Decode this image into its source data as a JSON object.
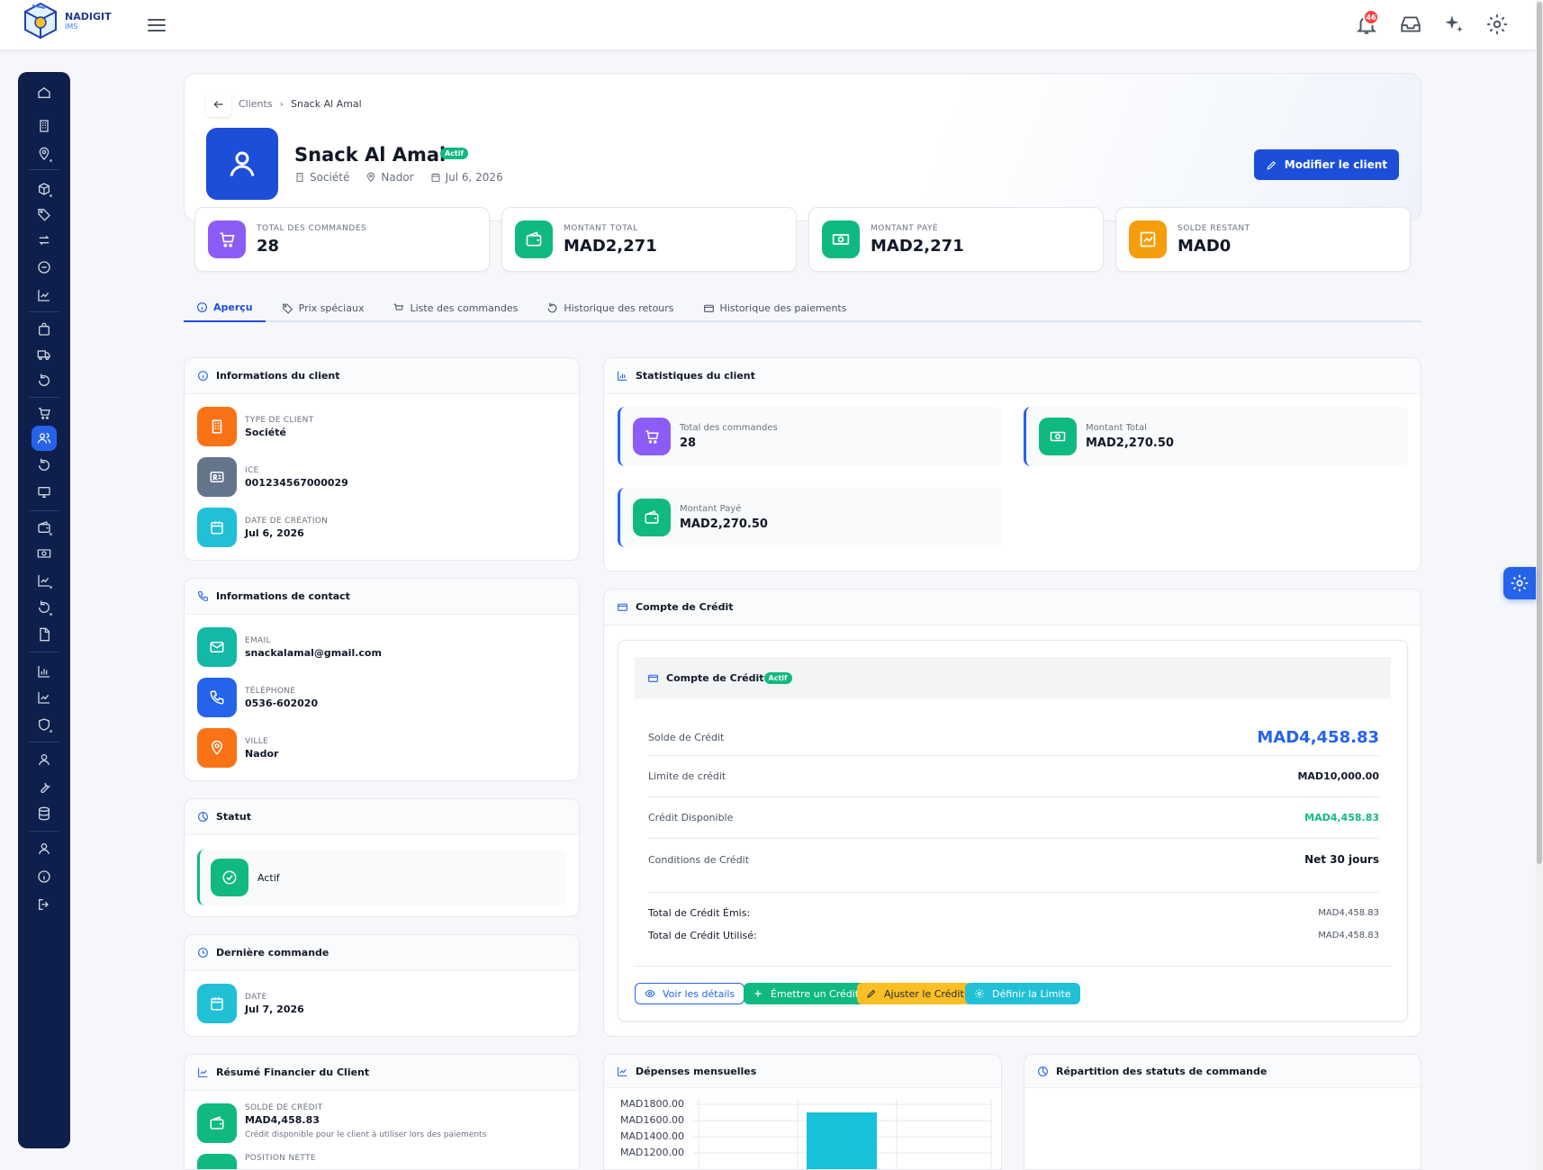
{
  "app": {
    "name": "NADIGIT",
    "subtitle": "IMS",
    "notification_count": "46"
  },
  "breadcrumb": {
    "parent": "Clients",
    "current": "Snack Al Amal"
  },
  "client": {
    "name": "Snack Al Amal",
    "status_badge": "Actif",
    "type": "Société",
    "city": "Nador",
    "created": "Jul 6, 2026",
    "edit_label": "Modifier le client"
  },
  "kpis": [
    {
      "label": "TOTAL DES COMMANDES",
      "value": "28",
      "color": "#8b5cf6",
      "icon": "cart-icon"
    },
    {
      "label": "MONTANT TOTAL",
      "value": "MAD2,271",
      "color": "#10b981",
      "icon": "wallet-icon"
    },
    {
      "label": "MONTANT PAYÉ",
      "value": "MAD2,271",
      "color": "#10b981",
      "icon": "cash-icon"
    },
    {
      "label": "SOLDE RESTANT",
      "value": "MAD0",
      "color": "#f59e0b",
      "icon": "chart-icon"
    }
  ],
  "tabs": [
    {
      "label": "Aperçu",
      "icon": "info-icon",
      "active": true
    },
    {
      "label": "Prix spéciaux",
      "icon": "tag-icon"
    },
    {
      "label": "Liste des commandes",
      "icon": "cart-icon"
    },
    {
      "label": "Historique des retours",
      "icon": "undo-icon"
    },
    {
      "label": "Historique des paiements",
      "icon": "card-icon"
    }
  ],
  "client_info": {
    "title": "Informations du client",
    "items": [
      {
        "label": "TYPE DE CLIENT",
        "value": "Société"
      },
      {
        "label": "ICE",
        "value": "001234567000029"
      },
      {
        "label": "DATE DE CRÉATION",
        "value": "Jul 6, 2026"
      }
    ]
  },
  "contact_info": {
    "title": "Informations de contact",
    "items": [
      {
        "label": "EMAIL",
        "value": "snackalamal@gmail.com"
      },
      {
        "label": "TÉLÉPHONE",
        "value": "0536-602020"
      },
      {
        "label": "VILLE",
        "value": "Nador"
      }
    ]
  },
  "statut": {
    "title": "Statut",
    "value": "Actif"
  },
  "last_order": {
    "title": "Dernière commande",
    "label": "DATE",
    "value": "Jul 7, 2026"
  },
  "financial_summary": {
    "title": "Résumé Financier du Client",
    "credit_label": "SOLDE DE CRÉDIT",
    "credit_value": "MAD4,458.83",
    "credit_note": "Crédit disponible pour le client à utiliser lors des paiements",
    "net_label": "POSITION NETTE"
  },
  "stats": {
    "title": "Statistiques du client",
    "items": [
      {
        "label": "Total des commandes",
        "value": "28"
      },
      {
        "label": "Montant Total",
        "value": "MAD2,270.50"
      },
      {
        "label": "Montant Payé",
        "value": "MAD2,270.50"
      }
    ]
  },
  "credit": {
    "card_title": "Compte de Crédit",
    "inner_title": "Compte de Crédit",
    "badge": "Actif",
    "balance_label": "Solde de Crédit",
    "balance_value": "MAD4,458.83",
    "limit_label": "Limite de crédit",
    "limit_value": "MAD10,000.00",
    "available_label": "Crédit Disponible",
    "available_value": "MAD4,458.83",
    "terms_label": "Conditions de Crédit",
    "terms_value": "Net 30 jours",
    "issued_label": "Total de Crédit Émis:",
    "issued_value": "MAD4,458.83",
    "used_label": "Total de Crédit Utilisé:",
    "used_value": "MAD4,458.83",
    "buttons": {
      "details": "Voir les détails",
      "issue": "Émettre un Crédit",
      "adjust": "Ajuster le Crédit",
      "limit": "Définir la Limite"
    }
  },
  "monthly": {
    "title": "Dépenses mensuelles"
  },
  "order_status": {
    "title": "Répartition des statuts de commande"
  },
  "chart_data": {
    "type": "bar",
    "title": "Dépenses mensuelles",
    "y_ticks": [
      "MAD1800.00",
      "MAD1600.00",
      "MAD1400.00",
      "MAD1200.00"
    ],
    "ylim_visible": [
      1200,
      1800
    ],
    "bar_color": "#17c1d8",
    "values": [
      1700
    ],
    "grid": true
  }
}
